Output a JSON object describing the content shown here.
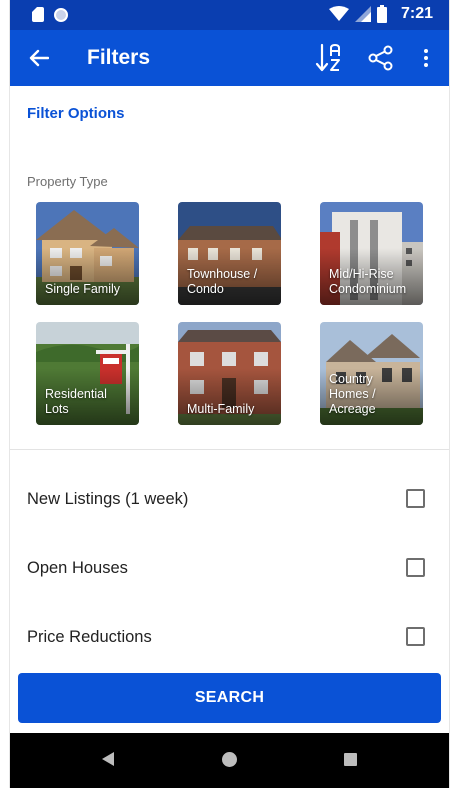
{
  "status_bar": {
    "time": "7:21",
    "icons": [
      "sd-card-icon",
      "circle-icon",
      "wifi-icon",
      "signal-icon",
      "battery-icon"
    ]
  },
  "app_bar": {
    "title": "Filters",
    "icons": [
      "back-arrow-icon",
      "sort-az-icon",
      "share-icon",
      "more-vert-icon"
    ],
    "color": "#0a52d6"
  },
  "filter_options_label": "Filter Options",
  "property_type": {
    "label": "Property Type",
    "tiles": [
      {
        "label": "Single Family"
      },
      {
        "label": "Townhouse /\nCondo"
      },
      {
        "label": "Mid/Hi-Rise\nCondominium"
      },
      {
        "label": "Residential\nLots"
      },
      {
        "label": "Multi-Family"
      },
      {
        "label": "Country\nHomes /\nAcreage"
      }
    ]
  },
  "checkboxes": [
    {
      "label": "New Listings (1 week)",
      "checked": false
    },
    {
      "label": "Open Houses",
      "checked": false
    },
    {
      "label": "Price Reductions",
      "checked": false
    }
  ],
  "search_button": "SEARCH",
  "nav_bar": {
    "icons": [
      "nav-back-icon",
      "nav-home-icon",
      "nav-recents-icon"
    ]
  },
  "colors": {
    "primary": "#0a52d6",
    "status_bar": "#0a3eb0"
  }
}
